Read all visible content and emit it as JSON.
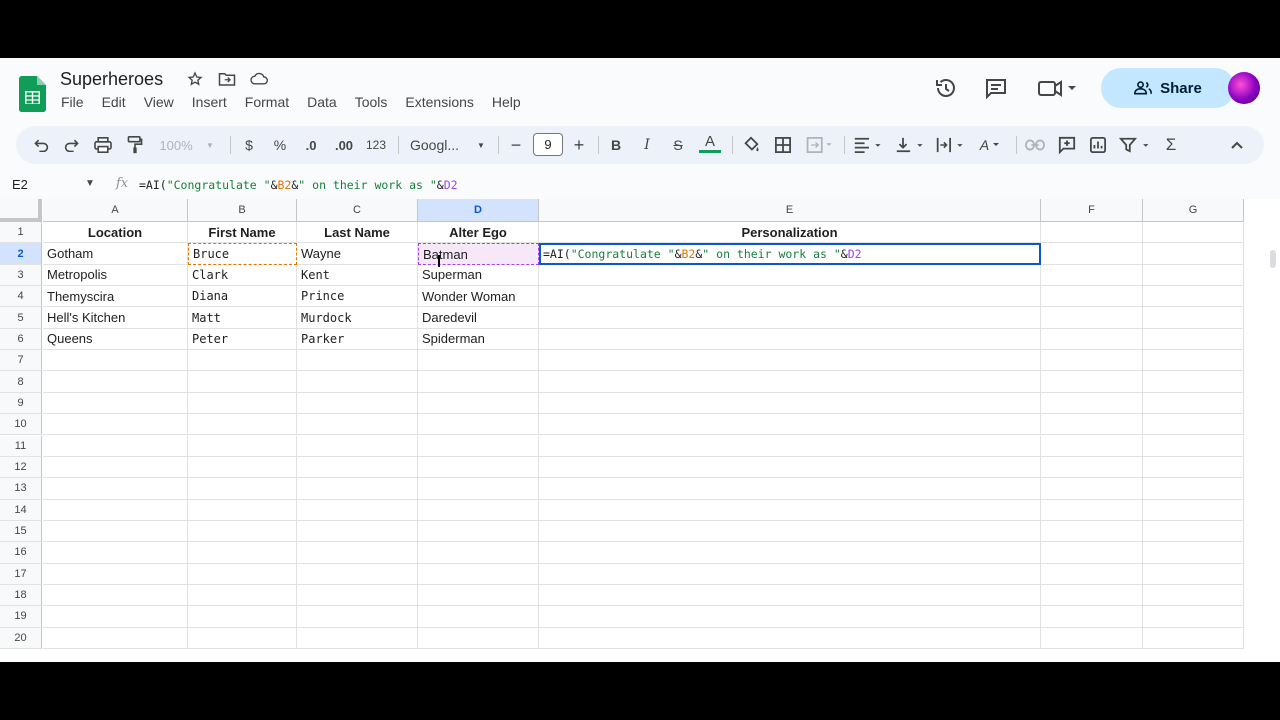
{
  "app": {
    "title": "Superheroes",
    "menu": [
      "File",
      "Edit",
      "View",
      "Insert",
      "Format",
      "Data",
      "Tools",
      "Extensions",
      "Help"
    ],
    "share_label": "Share"
  },
  "toolbar": {
    "zoom": "100%",
    "currency": "$",
    "percent": "%",
    "decimal_decrease": ".0",
    "decimal_increase": ".00",
    "format_number": "123",
    "font": "Googl...",
    "font_size": "9",
    "minus": "−",
    "plus": "+",
    "bold": "B",
    "italic": "I",
    "strike": "S",
    "text_color": "A",
    "text_format": "A",
    "sum": "Σ"
  },
  "formula_bar": {
    "cell_ref": "E2",
    "fx": "fx",
    "formula_parts": [
      {
        "text": "=AI(",
        "cls": ""
      },
      {
        "text": "\"Congratulate \"",
        "cls": "str-green"
      },
      {
        "text": "&",
        "cls": ""
      },
      {
        "text": "B2",
        "cls": "ref-orange"
      },
      {
        "text": "&",
        "cls": ""
      },
      {
        "text": "\" on their work as \"",
        "cls": "str-green"
      },
      {
        "text": "&",
        "cls": ""
      },
      {
        "text": "D2",
        "cls": "ref-purple"
      }
    ]
  },
  "columns": [
    "A",
    "B",
    "C",
    "D",
    "E",
    "F",
    "G"
  ],
  "rows": [
    "1",
    "2",
    "3",
    "4",
    "5",
    "6",
    "7",
    "8",
    "9",
    "10",
    "11",
    "12",
    "13",
    "14",
    "15",
    "16",
    "17",
    "18",
    "19",
    "20"
  ],
  "headers": [
    "Location",
    "First Name",
    "Last Name",
    "Alter Ego",
    "Personalization"
  ],
  "data": [
    [
      "Gotham",
      "Bruce",
      "Wayne",
      "Batman"
    ],
    [
      "Metropolis",
      "Clark",
      "Kent",
      "Superman"
    ],
    [
      "Themyscira",
      "Diana",
      "Prince",
      "Wonder Woman"
    ],
    [
      "Hell's Kitchen",
      "Matt",
      "Murdock",
      "Daredevil"
    ],
    [
      "Queens",
      "Peter",
      "Parker",
      "Spiderman"
    ]
  ],
  "selected_cell": "E2",
  "colors": {
    "accent": "#0b57d0",
    "share_bg": "#c2e7ff",
    "ref_b": "#e37400",
    "ref_d": "#a142f4"
  }
}
